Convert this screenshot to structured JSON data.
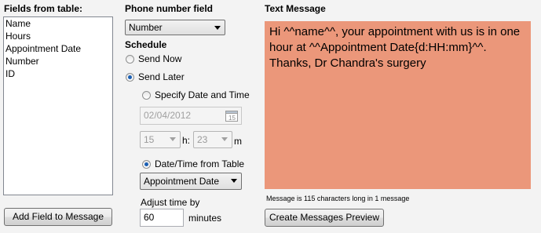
{
  "fields_panel": {
    "title": "Fields from table:",
    "items": [
      "Name",
      "Hours",
      "Appointment Date",
      "Number",
      "ID"
    ],
    "add_button": "Add Field to Message"
  },
  "phone_panel": {
    "title": "Phone number field",
    "selected": "Number"
  },
  "schedule": {
    "title": "Schedule",
    "send_now": "Send Now",
    "send_later": "Send Later",
    "specify": "Specify Date and Time",
    "date_value": "02/04/2012",
    "hour_value": "15",
    "hour_unit": "h:",
    "minute_value": "23",
    "minute_unit": "m",
    "from_table": "Date/Time from Table",
    "from_table_field": "Appointment Date",
    "adjust_label": "Adjust time by",
    "adjust_value": "60",
    "adjust_unit": "minutes"
  },
  "message_panel": {
    "title": "Text Message",
    "text": "Hi ^^name^^, your appointment with us is in one hour at ^^Appointment Date{d:HH:mm}^^. Thanks, Dr Chandra's surgery",
    "status": "Message is 115 characters long in 1 message",
    "preview_button": "Create Messages Preview",
    "color": "#eb977a"
  }
}
